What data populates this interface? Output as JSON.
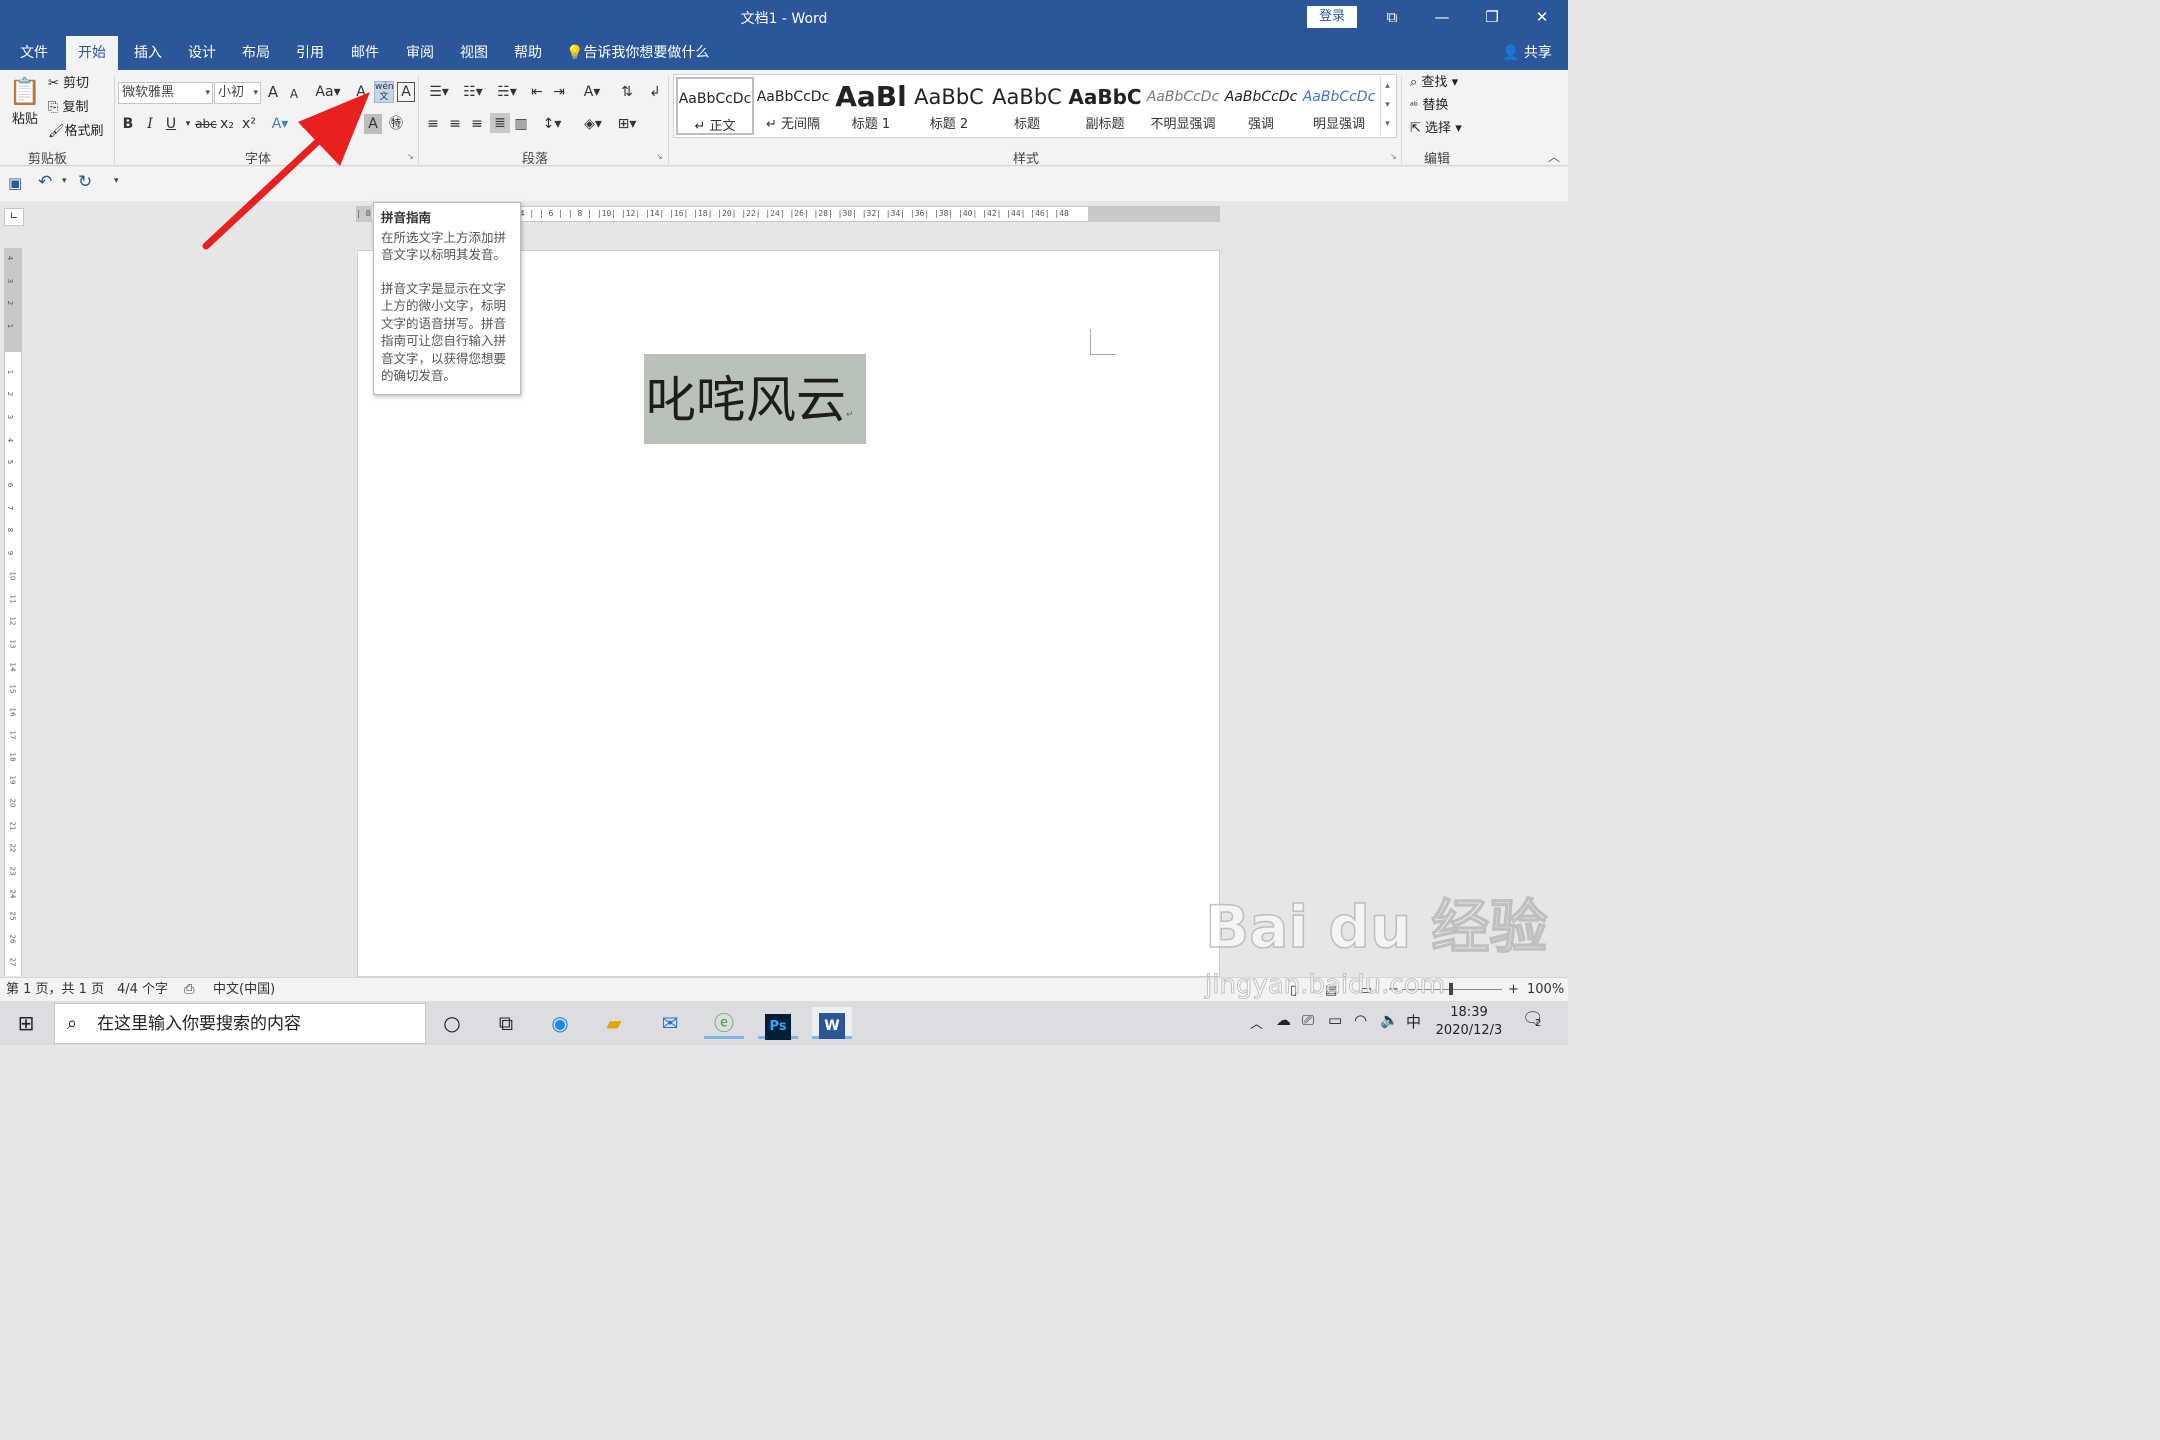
{
  "window": {
    "title": "文档1  -  Word",
    "login_label": "登录",
    "controls": [
      "ribbon-display-icon",
      "minimize-icon",
      "restore-icon",
      "close-icon"
    ]
  },
  "tabs": [
    {
      "label": "文件",
      "active": false
    },
    {
      "label": "开始",
      "active": true
    },
    {
      "label": "插入",
      "active": false
    },
    {
      "label": "设计",
      "active": false
    },
    {
      "label": "布局",
      "active": false
    },
    {
      "label": "引用",
      "active": false
    },
    {
      "label": "邮件",
      "active": false
    },
    {
      "label": "审阅",
      "active": false
    },
    {
      "label": "视图",
      "active": false
    },
    {
      "label": "帮助",
      "active": false
    }
  ],
  "tell_me": "告诉我你想要做什么",
  "share_label": "共享",
  "clipboard": {
    "paste": "粘贴",
    "cut": "剪切",
    "copy": "复制",
    "format_painter": "格式刷",
    "group": "剪贴板"
  },
  "font": {
    "font_name": "微软雅黑",
    "font_size": "小初",
    "grow": "A",
    "shrink": "A",
    "change_case": "Aa",
    "bold": "B",
    "italic": "I",
    "underline": "U",
    "strike": "abc",
    "subscript": "x₂",
    "superscript": "x²",
    "group": "字体"
  },
  "paragraph": {
    "group": "段落"
  },
  "styles": {
    "group": "样式",
    "items": [
      {
        "sample": "AaBbCcDc",
        "name": "↵ 正文"
      },
      {
        "sample": "AaBbCcDc",
        "name": "↵ 无间隔"
      },
      {
        "sample": "AaBl",
        "name": "标题 1"
      },
      {
        "sample": "AaBbC",
        "name": "标题 2"
      },
      {
        "sample": "AaBbC",
        "name": "标题"
      },
      {
        "sample": "AaBbC",
        "name": "副标题"
      },
      {
        "sample": "AaBbCcDc",
        "name": "不明显强调"
      },
      {
        "sample": "AaBbCcDc",
        "name": "强调"
      },
      {
        "sample": "AaBbCcDc",
        "name": "明显强调"
      }
    ]
  },
  "editing": {
    "find": "查找",
    "replace": "替换",
    "select": "选择",
    "group": "编辑"
  },
  "tooltip": {
    "title": "拼音指南",
    "line1": "在所选文字上方添加拼音文字以标明其发音。",
    "line2": "拼音文字是显示在文字上方的微小文字，标明文字的语音拼写。拼音指南可让您自行输入拼音文字，以获得您想要的确切发音。"
  },
  "ruler": {
    "h": "| 8 |  | 6 |  | 4 |  | 2 |     |     | 2 |   | 4 |   | 6 |   | 8 |   |10|   |12|   |14|   |16|   |18|   |20|   |22|   |24|   |26|   |28|   |30|   |32|   |34|   |36|   |38|   |40|   |42|   |44|   |46|   |48"
  },
  "document": {
    "text": "叱咤风云"
  },
  "status": {
    "page": "第 1 页，共 1 页",
    "words": "4/4 个字",
    "language": "中文(中国)",
    "zoom": "100%"
  },
  "taskbar": {
    "search_placeholder": "在这里输入你要搜索的内容",
    "time": "18:39",
    "date": "2020/12/3",
    "ime": "中",
    "notification_count": "2"
  },
  "watermark": {
    "brand": "Bai du 经验",
    "url": "jingyan.baidu.com"
  },
  "colors": {
    "title_bar": "#2b579a",
    "selection": "#b9c2b8",
    "arrow": "#e8201f"
  }
}
